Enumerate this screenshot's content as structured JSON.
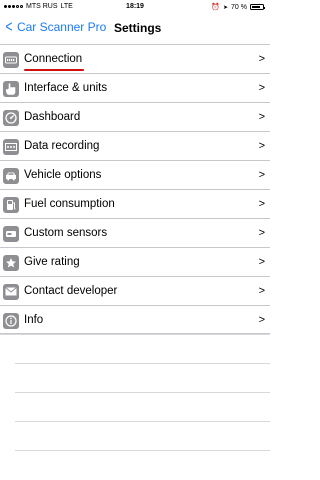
{
  "status_bar": {
    "carrier": "MTS RUS",
    "network": "LTE",
    "time": "18:19",
    "battery": "70 %"
  },
  "nav": {
    "back_label": "Car Scanner Pro",
    "title": "Settings"
  },
  "settings": {
    "items": [
      {
        "label": "Connection",
        "icon": "connector-icon"
      },
      {
        "label": "Interface & units",
        "icon": "hand-pointer-icon"
      },
      {
        "label": "Dashboard",
        "icon": "gauge-icon"
      },
      {
        "label": "Data recording",
        "icon": "recording-icon"
      },
      {
        "label": "Vehicle options",
        "icon": "car-icon"
      },
      {
        "label": "Fuel consumption",
        "icon": "fuel-pump-icon"
      },
      {
        "label": "Custom sensors",
        "icon": "sensor-icon"
      },
      {
        "label": "Give rating",
        "icon": "star-icon"
      },
      {
        "label": "Contact developer",
        "icon": "envelope-icon"
      },
      {
        "label": "Info",
        "icon": "info-icon"
      }
    ],
    "chevron": ">"
  },
  "colors": {
    "accent": "#1a7cf2",
    "icon_bg": "#8e8e93",
    "highlight": "#d01010"
  }
}
